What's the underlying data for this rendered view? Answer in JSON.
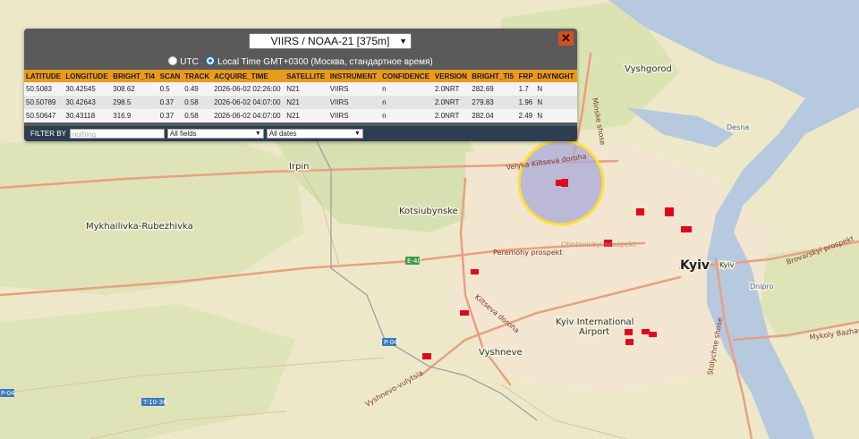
{
  "popup": {
    "sensor_selected": "VIIRS / NOAA-21 [375m]",
    "close_symbol": "✕",
    "tz_utc_label": "UTC",
    "tz_local_label": "Local Time GMT+0300 (Москва, стандартное время)",
    "tz_selected": "local"
  },
  "table": {
    "columns": [
      "LATITUDE",
      "LONGITUDE",
      "BRIGHT_TI4",
      "SCAN",
      "TRACK",
      "ACQUIRE_TIME",
      "SATELLITE",
      "INSTRUMENT",
      "CONFIDENCE",
      "VERSION",
      "BRIGHT_TI5",
      "FRP",
      "DAYNIGHT"
    ],
    "rows": [
      [
        "50.5083",
        "30.42545",
        "308.62",
        "0.5",
        "0.49",
        "2026-06-02 02:26:00",
        "N21",
        "VIIRS",
        "n",
        "2.0NRT",
        "282.69",
        "1.7",
        "N"
      ],
      [
        "50.50789",
        "30.42643",
        "298.5",
        "0.37",
        "0.58",
        "2026-06-02 04:07:00",
        "N21",
        "VIIRS",
        "n",
        "2.0NRT",
        "279.83",
        "1.96",
        "N"
      ],
      [
        "50.50647",
        "30.43118",
        "316.9",
        "0.37",
        "0.58",
        "2026-06-02 04:07:00",
        "N21",
        "VIIRS",
        "n",
        "2.0NRT",
        "282.04",
        "2.49",
        "N"
      ]
    ]
  },
  "filter": {
    "label": "FILTER BY",
    "input_placeholder": "nothing",
    "field_select": "All fields",
    "date_select": "All dates"
  },
  "map": {
    "place_labels": {
      "vyshgorod": "Vyshgorod",
      "irpin": "Irpin",
      "kotsiubynske": "Kotsiubynske",
      "mykhailivka": "Mykhailivka-Rubezhivka",
      "kyiv": "Kyiv",
      "kyiv_small": "Kyiv",
      "airport_line1": "Kyiv International",
      "airport_line2": "Airport",
      "vyshneve": "Vyshneve",
      "dnipro": "Dnipro",
      "desna": "Desna"
    },
    "road_labels": {
      "kiltseva_north": "Velyka Kiltseva doroha",
      "peremohy": "Peremohy prospekt",
      "obolonskyi": "Oboloniskyi prospekt",
      "kiltseva_west": "Kiltseva doroha",
      "brovarskyi": "Brovarskyi prospekt",
      "bazhana": "Mykoly Bazhana",
      "stolychne": "Stolychne shose",
      "mintsk": "Minske shose",
      "vasylkivska": "Vyshnevo-vulytsia"
    },
    "road_shields": {
      "e40": "E-40",
      "p04a": "P-04",
      "p04b": "P-04",
      "t1036": "T-10-36"
    },
    "colors": {
      "land": "#ede9c8",
      "water": "#b7c9de",
      "green": "#d6e0b0",
      "urban": "#f2e6d0",
      "road": "#e8a080",
      "fire": "#e2061c",
      "highlight_fill": "#a9a9d8",
      "highlight_ring": "#ffe033"
    }
  }
}
